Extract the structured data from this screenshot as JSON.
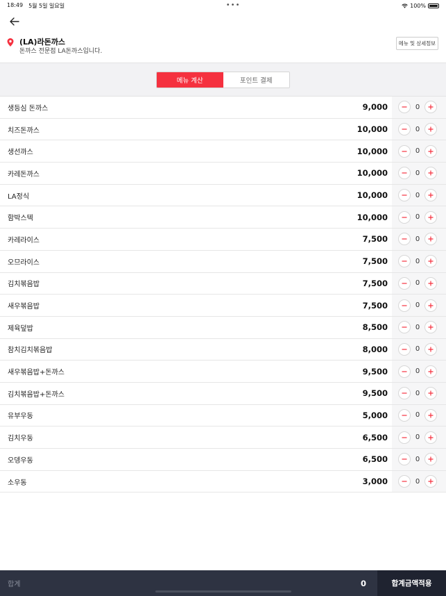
{
  "status_bar": {
    "time": "18:49",
    "date": "5월 5일 일요일",
    "dots": "•••",
    "battery": "100%"
  },
  "store": {
    "name": "(LA)라돈까스",
    "description": "돈까스 전문점 LA돈까스입니다.",
    "detail_button": "메뉴 및 상세정보"
  },
  "tabs": [
    {
      "label": "메뉴 계산",
      "active": true
    },
    {
      "label": "포인트 결제",
      "active": false
    }
  ],
  "menu_items": [
    {
      "name": "생등심 돈까스",
      "price": "9,000",
      "qty": "0"
    },
    {
      "name": "치즈돈까스",
      "price": "10,000",
      "qty": "0"
    },
    {
      "name": "생선까스",
      "price": "10,000",
      "qty": "0"
    },
    {
      "name": "카레돈까스",
      "price": "10,000",
      "qty": "0"
    },
    {
      "name": "LA정식",
      "price": "10,000",
      "qty": "0"
    },
    {
      "name": "함박스텍",
      "price": "10,000",
      "qty": "0"
    },
    {
      "name": "카레라이스",
      "price": "7,500",
      "qty": "0"
    },
    {
      "name": "오므라이스",
      "price": "7,500",
      "qty": "0"
    },
    {
      "name": "김치볶음밥",
      "price": "7,500",
      "qty": "0"
    },
    {
      "name": "새우볶음밥",
      "price": "7,500",
      "qty": "0"
    },
    {
      "name": "제육덮밥",
      "price": "8,500",
      "qty": "0"
    },
    {
      "name": "참치김치볶음밥",
      "price": "8,000",
      "qty": "0"
    },
    {
      "name": "새우볶음밥+돈까스",
      "price": "9,500",
      "qty": "0"
    },
    {
      "name": "김치볶음밥+돈까스",
      "price": "9,500",
      "qty": "0"
    },
    {
      "name": "유부우동",
      "price": "5,000",
      "qty": "0"
    },
    {
      "name": "김치우동",
      "price": "6,500",
      "qty": "0"
    },
    {
      "name": "오뎅우동",
      "price": "6,500",
      "qty": "0"
    },
    {
      "name": "소우동",
      "price": "3,000",
      "qty": "0"
    }
  ],
  "bottom": {
    "total_label": "합계",
    "total_value": "0",
    "apply_button": "합계금액적용"
  },
  "colors": {
    "accent": "#f5313f",
    "bottom_bar": "#2e3342"
  }
}
